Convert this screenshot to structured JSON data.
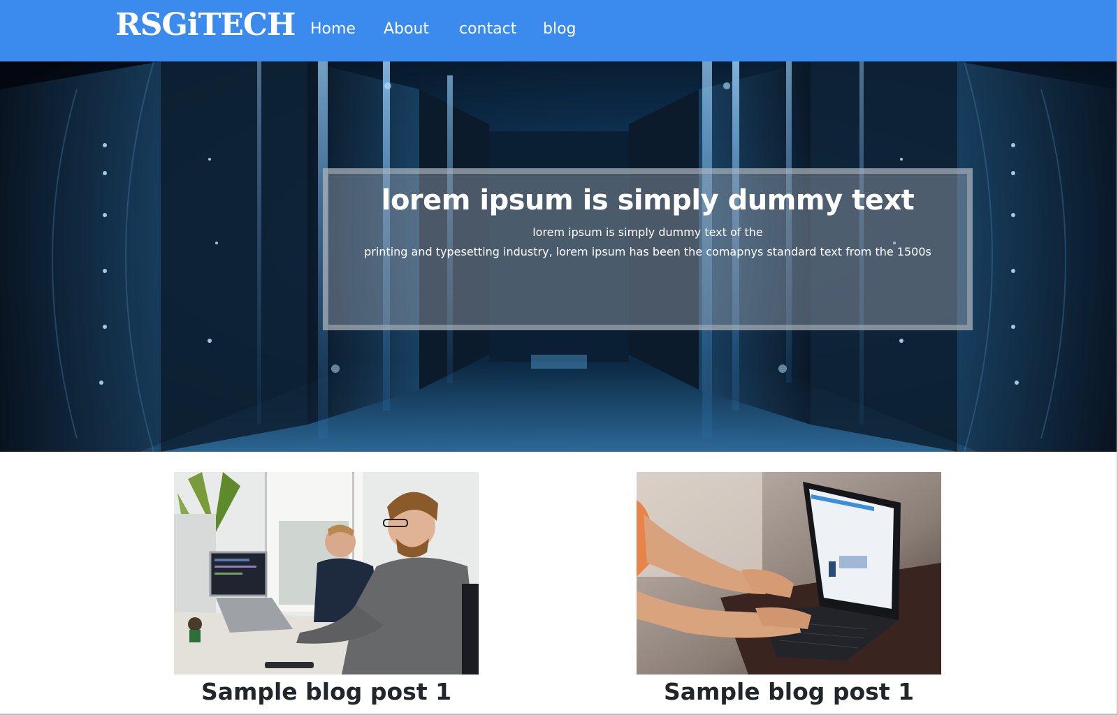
{
  "header": {
    "logo": "RSGiTECH",
    "nav": [
      "Home",
      "About",
      "contact",
      "blog"
    ],
    "background_color": "#3b8aed"
  },
  "hero": {
    "title": "lorem ipsum is simply dummy text",
    "line1": "lorem ipsum is simply dummy text of the",
    "line2": "printing and typesetting industry, lorem ipsum has been the comapnys standard text from the 1500s",
    "image": "server-room-corridor"
  },
  "posts": [
    {
      "title": "Sample blog post 1",
      "image": "office-developers-photo"
    },
    {
      "title": "Sample blog post 1",
      "image": "laptop-typing-photo"
    }
  ]
}
